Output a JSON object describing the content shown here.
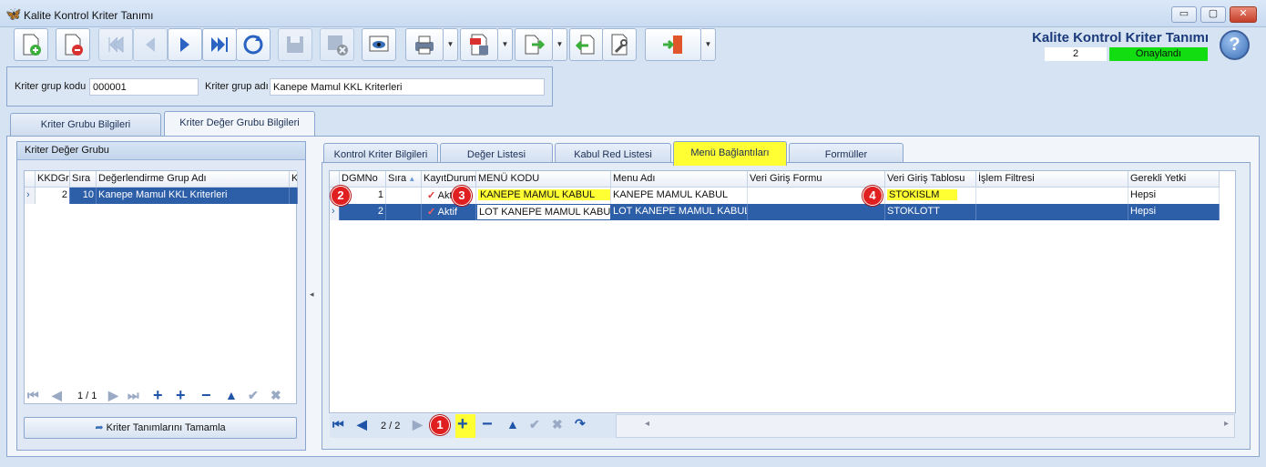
{
  "window": {
    "title": "Kalite Kontrol Kriter Tanımı",
    "min": "▭",
    "max": "▢",
    "close": "✕"
  },
  "header": {
    "form_title": "Kalite Kontrol Kriter Tanımı",
    "record_no": "2",
    "status": "Onaylandı",
    "status_color": "#11dd11"
  },
  "toolbar": {
    "icons": [
      "new-icon",
      "delete-icon",
      "first-icon",
      "prev-icon",
      "next-icon",
      "last-icon",
      "refresh-icon",
      "save-icon",
      "save-close-icon",
      "preview-icon",
      "print-icon",
      "pdf-export-icon",
      "transfer-icon",
      "import-icon",
      "tools-icon",
      "exit-icon"
    ]
  },
  "fields": {
    "kod_label": "Kriter grup kodu",
    "kod_value": "000001",
    "adi_label": "Kriter grup adı",
    "adi_value": "Kanepe Mamul KKL Kriterleri"
  },
  "outer_tabs": [
    "Kriter Grubu Bilgileri",
    "Kriter Değer Grubu Bilgileri"
  ],
  "left_panel": {
    "title": "Kriter Değer Grubu",
    "columns": [
      "KKDGr",
      "Sıra",
      "Değerlendirme Grup Adı",
      "K"
    ],
    "rows": [
      {
        "id": "2",
        "sira": "10",
        "name": "Kanepe Mamul KKL Kriterleri"
      }
    ],
    "pager": "1 / 1",
    "complete_button": "Kriter Tanımlarını Tamamla"
  },
  "inner_tabs": [
    "Kontrol Kriter Bilgileri",
    "Değer Listesi",
    "Kabul Red Listesi",
    "Menü Bağlantıları",
    "Formüller"
  ],
  "grid": {
    "columns": [
      "DGMNo",
      "Sıra",
      "KayıtDurum",
      "MENÜ KODU",
      "Menu Adı",
      "Veri Giriş Formu",
      "Veri Giriş Tablosu",
      "İşlem Filtresi",
      "Gerekli Yetki"
    ],
    "rows": [
      {
        "no": "1",
        "sira": "",
        "durum": "Aktif",
        "kod": "KANEPE MAMUL KABUL",
        "ad": "KANEPE MAMUL KABUL",
        "form": "",
        "tablo": "STOKISLM",
        "filtre": "",
        "yetki": "Hepsi"
      },
      {
        "no": "2",
        "sira": "",
        "durum": "Aktif",
        "kod": "LOT KANEPE MAMUL KABUL",
        "ad": "LOT KANEPE MAMUL KABUL",
        "form": "",
        "tablo": "STOKLOTT",
        "filtre": "",
        "yetki": "Hepsi"
      }
    ],
    "pager": "2 / 2"
  },
  "markers": [
    "1",
    "2",
    "3",
    "4"
  ],
  "highlight_color": "#ffff33"
}
